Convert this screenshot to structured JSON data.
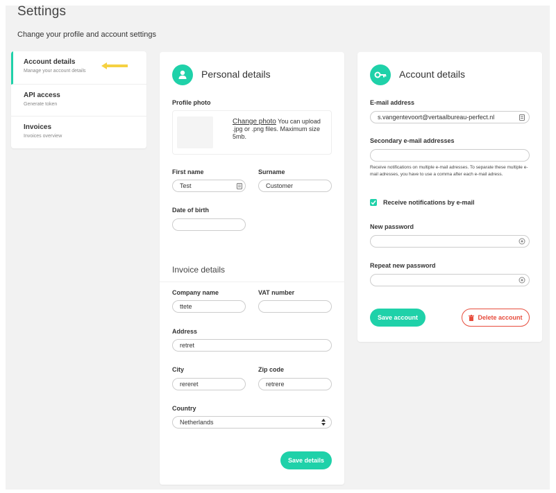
{
  "header": {
    "title": "Settings",
    "subtitle": "Change your profile and account settings"
  },
  "sidebar": {
    "items": [
      {
        "title": "Account details",
        "subtitle": "Manage your account details",
        "active": true
      },
      {
        "title": "API access",
        "subtitle": "Generate token",
        "active": false
      },
      {
        "title": "Invoices",
        "subtitle": "Invoices overview",
        "active": false
      }
    ]
  },
  "personal": {
    "title": "Personal details",
    "icon": "user-icon",
    "profile_photo_label": "Profile photo",
    "change_photo_link": "Change photo",
    "photo_hint": " You can upload .jpg or .png files. Maximum size 5mb.",
    "first_name_label": "First name",
    "first_name_value": "Test",
    "surname_label": "Surname",
    "surname_value": "Customer",
    "dob_label": "Date of birth",
    "dob_value": ""
  },
  "invoice": {
    "title": "Invoice details",
    "company_label": "Company name",
    "company_value": "ttete",
    "vat_label": "VAT number",
    "vat_value": "",
    "address_label": "Address",
    "address_value": "retret",
    "city_label": "City",
    "city_value": "rereret",
    "zip_label": "Zip code",
    "zip_value": "retrere",
    "country_label": "Country",
    "country_value": "Netherlands",
    "save_label": "Save details"
  },
  "account": {
    "title": "Account details",
    "icon": "key-icon",
    "email_label": "E-mail address",
    "email_value": "s.vangentevoort@vertaalbureau-perfect.nl",
    "secondary_label": "Secondary e-mail addresses",
    "secondary_value": "",
    "secondary_help": "Receive notifications on multiple e-mail adresses. To separate these multiple e-mail adresses, you have to use a comma after each e-mail adress.",
    "notify_label": "Receive notifications by e-mail",
    "notify_checked": true,
    "new_password_label": "New password",
    "repeat_password_label": "Repeat new password",
    "save_label": "Save account",
    "delete_label": "Delete account"
  },
  "colors": {
    "accent": "#1fd1a9",
    "danger": "#e74c3c",
    "arrow": "#f5d142"
  }
}
